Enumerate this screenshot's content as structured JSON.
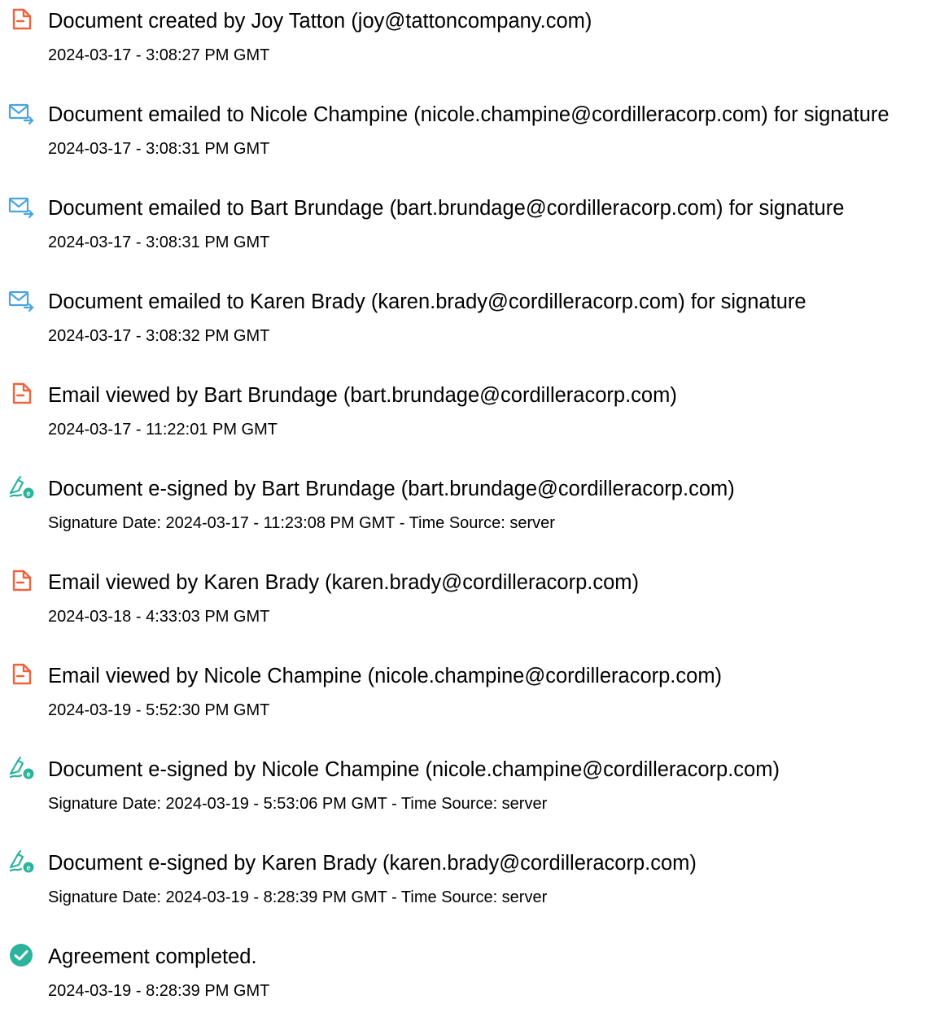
{
  "colors": {
    "pdf_icon": "#f0623c",
    "email_icon": "#4aa3df",
    "sign_icon": "#2bb39c",
    "check_icon": "#2bb39c"
  },
  "events": [
    {
      "icon": "pdf-document-icon",
      "title": "Document created by Joy Tatton (joy@tattoncompany.com)",
      "meta": "2024-03-17 - 3:08:27 PM GMT"
    },
    {
      "icon": "email-sent-icon",
      "title": "Document emailed to Nicole Champine (nicole.champine@cordilleracorp.com) for signature",
      "meta": "2024-03-17 - 3:08:31 PM GMT"
    },
    {
      "icon": "email-sent-icon",
      "title": "Document emailed to Bart Brundage (bart.brundage@cordilleracorp.com) for signature",
      "meta": "2024-03-17 - 3:08:31 PM GMT"
    },
    {
      "icon": "email-sent-icon",
      "title": "Document emailed to Karen Brady (karen.brady@cordilleracorp.com) for signature",
      "meta": "2024-03-17 - 3:08:32 PM GMT"
    },
    {
      "icon": "pdf-document-icon",
      "title": "Email viewed by Bart Brundage (bart.brundage@cordilleracorp.com)",
      "meta": "2024-03-17 - 11:22:01 PM GMT"
    },
    {
      "icon": "e-sign-pen-icon",
      "title": "Document e-signed by Bart Brundage (bart.brundage@cordilleracorp.com)",
      "meta": "Signature Date: 2024-03-17 - 11:23:08 PM GMT - Time Source: server"
    },
    {
      "icon": "pdf-document-icon",
      "title": "Email viewed by Karen Brady (karen.brady@cordilleracorp.com)",
      "meta": "2024-03-18 - 4:33:03 PM GMT"
    },
    {
      "icon": "pdf-document-icon",
      "title": "Email viewed by Nicole Champine (nicole.champine@cordilleracorp.com)",
      "meta": "2024-03-19 - 5:52:30 PM GMT"
    },
    {
      "icon": "e-sign-pen-icon",
      "title": "Document e-signed by Nicole Champine (nicole.champine@cordilleracorp.com)",
      "meta": "Signature Date: 2024-03-19 - 5:53:06 PM GMT - Time Source: server"
    },
    {
      "icon": "e-sign-pen-icon",
      "title": "Document e-signed by Karen Brady (karen.brady@cordilleracorp.com)",
      "meta": "Signature Date: 2024-03-19 - 8:28:39 PM GMT - Time Source: server"
    },
    {
      "icon": "check-circle-icon",
      "title": "Agreement completed.",
      "meta": "2024-03-19 - 8:28:39 PM GMT"
    }
  ]
}
